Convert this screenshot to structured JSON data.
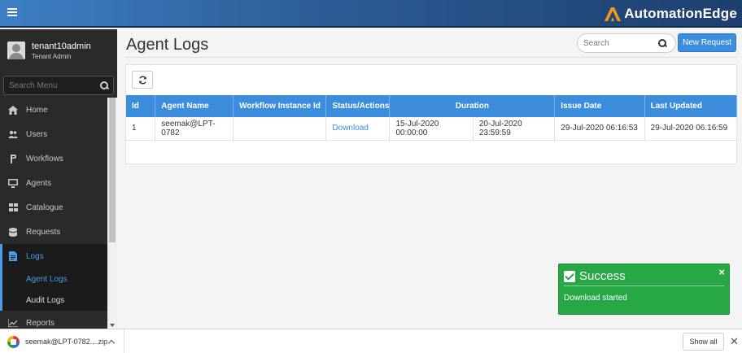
{
  "header": {
    "brand": "AutomationEdge",
    "brand_color": "#f39c12",
    "menu_icon": "hamburger-icon"
  },
  "sidebar": {
    "user": {
      "name": "tenant10admin",
      "role": "Tenant Admin"
    },
    "search_placeholder": "Search Menu",
    "items": [
      {
        "label": "Home",
        "icon": "home-icon"
      },
      {
        "label": "Users",
        "icon": "users-icon"
      },
      {
        "label": "Workflows",
        "icon": "workflow-icon"
      },
      {
        "label": "Agents",
        "icon": "monitor-icon"
      },
      {
        "label": "Catalogue",
        "icon": "grid-icon"
      },
      {
        "label": "Requests",
        "icon": "database-icon"
      },
      {
        "label": "Logs",
        "icon": "document-icon",
        "active": true
      },
      {
        "label": "Reports",
        "icon": "chart-icon"
      }
    ],
    "sub_items": [
      {
        "label": "Agent Logs",
        "active": true
      },
      {
        "label": "Audit Logs"
      }
    ]
  },
  "main": {
    "title": "Agent Logs",
    "search_placeholder": "Search",
    "new_request_label": "New Request",
    "table": {
      "columns": [
        "Id",
        "Agent Name",
        "Workflow Instance Id",
        "Status/Actions",
        "Duration",
        "Issue Date",
        "Last Updated"
      ],
      "rows": [
        {
          "id": "1",
          "agent_name": "seemak@LPT-0782",
          "workflow_instance_id": "",
          "action": "Download",
          "duration_start": "15-Jul-2020 00:00:00",
          "duration_end": "20-Jul-2020 23:59:59",
          "issue_date": "29-Jul-2020 06:16:53",
          "last_updated": "29-Jul-2020 06:16:59"
        }
      ]
    }
  },
  "toast": {
    "title": "Success",
    "message": "Download started",
    "close": "×",
    "color": "#28a745"
  },
  "download_bar": {
    "file_name": "seemak@LPT-0782....zip",
    "show_all": "Show all",
    "close": "✕"
  }
}
